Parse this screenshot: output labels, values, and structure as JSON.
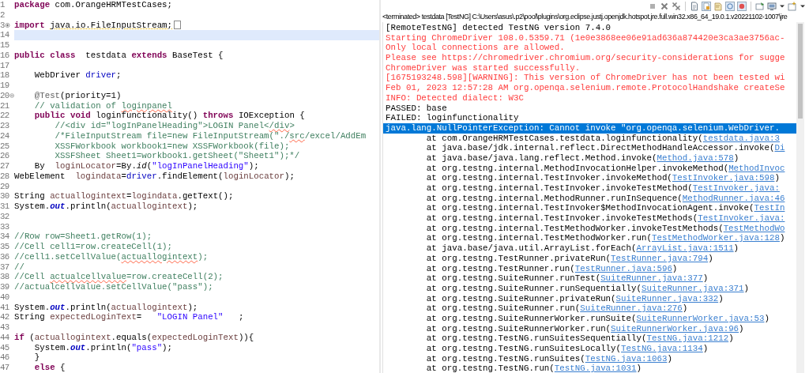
{
  "editor": {
    "lines": [
      {
        "number": "1",
        "current": false,
        "segments": [
          {
            "kind": "keyword",
            "text": "package"
          },
          {
            "kind": "plain",
            "text": " com.OrangeHRMTestCases;"
          }
        ]
      },
      {
        "number": "2",
        "current": false
      },
      {
        "number": "3",
        "current": false,
        "collapsed": true,
        "segments": [
          {
            "kind": "keyword",
            "text": "import "
          },
          {
            "kind": "plain",
            "text": "java.io.FileInputStream;",
            "warning": true
          }
        ]
      },
      {
        "number": "14",
        "current": true
      },
      {
        "number": "15",
        "current": false
      },
      {
        "number": "16",
        "current": false,
        "segments": [
          {
            "kind": "keyword",
            "text": "public class"
          },
          {
            "kind": "plain",
            "text": "  testdata "
          },
          {
            "kind": "keyword",
            "text": "extends"
          },
          {
            "kind": "plain",
            "text": " BaseTest {"
          }
        ]
      },
      {
        "number": "17",
        "current": false
      },
      {
        "number": "18",
        "current": false,
        "segments": [
          {
            "kind": "plain",
            "text": "    WebDriver "
          },
          {
            "kind": "field",
            "text": "driver"
          },
          {
            "kind": "plain",
            "text": ";"
          }
        ]
      },
      {
        "number": "19",
        "current": false
      },
      {
        "number": "20",
        "current": false,
        "collapsed": false,
        "segments": [
          {
            "kind": "annotation",
            "text": "    @Test"
          },
          {
            "kind": "plain",
            "text": "(priority=1)"
          }
        ]
      },
      {
        "number": "21",
        "current": false,
        "segments": [
          {
            "kind": "comment",
            "text": "    // validation of "
          },
          {
            "kind": "comment",
            "text": "loginpanel",
            "misspelled": true
          }
        ]
      },
      {
        "number": "22",
        "current": false,
        "segments": [
          {
            "kind": "keyword",
            "text": "    public void"
          },
          {
            "kind": "plain",
            "text": " loginfunctionality() "
          },
          {
            "kind": "keyword",
            "text": "throws"
          },
          {
            "kind": "plain",
            "text": " IOException {"
          }
        ]
      },
      {
        "number": "23",
        "current": false,
        "segments": [
          {
            "kind": "comment",
            "text": "        //<div id=\"logInPanelHeading\">LOGIN Panel<"
          },
          {
            "kind": "comment",
            "text": "/div",
            "misspelled": true
          },
          {
            "kind": "comment",
            "text": ">"
          }
        ]
      },
      {
        "number": "24",
        "current": false,
        "segments": [
          {
            "kind": "comment",
            "text": "        /*FileInputStream file=new FileInputStream(\"./"
          },
          {
            "kind": "comment",
            "text": "src",
            "misspelled": true
          },
          {
            "kind": "comment",
            "text": "/excel/AddEm"
          }
        ]
      },
      {
        "number": "25",
        "current": false,
        "segments": [
          {
            "kind": "comment",
            "text": "        XSSFWorkbook workbook1=new XSSFWorkbook(file);"
          }
        ]
      },
      {
        "number": "26",
        "current": false,
        "segments": [
          {
            "kind": "comment",
            "text": "        XSSFSheet Sheet1=workbook1.getSheet(\"Sheet1\");*/"
          }
        ]
      },
      {
        "number": "27",
        "current": false,
        "segments": [
          {
            "kind": "plain",
            "text": "    By  "
          },
          {
            "kind": "local",
            "text": "loginLocator"
          },
          {
            "kind": "plain",
            "text": "=By."
          },
          {
            "kind": "static-method",
            "text": "id"
          },
          {
            "kind": "plain",
            "text": "("
          },
          {
            "kind": "string",
            "text": "\"logInPanelHeading\""
          },
          {
            "kind": "plain",
            "text": ");"
          }
        ]
      },
      {
        "number": "28",
        "current": false,
        "segments": [
          {
            "kind": "plain",
            "text": "WebElement  "
          },
          {
            "kind": "local",
            "text": "logindata"
          },
          {
            "kind": "plain",
            "text": "="
          },
          {
            "kind": "field",
            "text": "driver"
          },
          {
            "kind": "plain",
            "text": ".findElement("
          },
          {
            "kind": "local",
            "text": "loginLocator"
          },
          {
            "kind": "plain",
            "text": ");"
          }
        ]
      },
      {
        "number": "29",
        "current": false
      },
      {
        "number": "30",
        "current": false,
        "segments": [
          {
            "kind": "plain",
            "text": "String "
          },
          {
            "kind": "local",
            "text": "actuallogintext"
          },
          {
            "kind": "plain",
            "text": "="
          },
          {
            "kind": "local",
            "text": "logindata"
          },
          {
            "kind": "plain",
            "text": ".getText();"
          }
        ]
      },
      {
        "number": "31",
        "current": false,
        "segments": [
          {
            "kind": "plain",
            "text": "System."
          },
          {
            "kind": "static-field",
            "text": "out"
          },
          {
            "kind": "plain",
            "text": ".println("
          },
          {
            "kind": "local",
            "text": "actuallogintext"
          },
          {
            "kind": "plain",
            "text": ");"
          }
        ]
      },
      {
        "number": "32",
        "current": false
      },
      {
        "number": "33",
        "current": false
      },
      {
        "number": "34",
        "current": false,
        "segments": [
          {
            "kind": "comment",
            "text": "//Row row=Sheet1.getRow(1);"
          }
        ]
      },
      {
        "number": "35",
        "current": false,
        "segments": [
          {
            "kind": "comment",
            "text": "//Cell cell1=row.createCell(1);"
          }
        ]
      },
      {
        "number": "36",
        "current": false,
        "segments": [
          {
            "kind": "comment",
            "text": "//cell1.setCellValue("
          },
          {
            "kind": "comment",
            "text": "actuallogintext",
            "misspelled": true
          },
          {
            "kind": "comment",
            "text": ");"
          }
        ]
      },
      {
        "number": "37",
        "current": false,
        "segments": [
          {
            "kind": "comment",
            "text": "//"
          }
        ]
      },
      {
        "number": "38",
        "current": false,
        "segments": [
          {
            "kind": "comment",
            "text": "//Cell "
          },
          {
            "kind": "comment",
            "text": "actualcellvalue",
            "misspelled": true
          },
          {
            "kind": "comment",
            "text": "=row.createCell(2);"
          }
        ]
      },
      {
        "number": "39",
        "current": false,
        "segments": [
          {
            "kind": "comment",
            "text": "//actualcellvalue.setCellValue(\"pass\");"
          }
        ]
      },
      {
        "number": "40",
        "current": false
      },
      {
        "number": "41",
        "current": false,
        "segments": [
          {
            "kind": "plain",
            "text": "System."
          },
          {
            "kind": "static-field",
            "text": "out"
          },
          {
            "kind": "plain",
            "text": ".println("
          },
          {
            "kind": "local",
            "text": "actuallogintext"
          },
          {
            "kind": "plain",
            "text": ");"
          }
        ]
      },
      {
        "number": "42",
        "current": false,
        "segments": [
          {
            "kind": "plain",
            "text": "String "
          },
          {
            "kind": "local",
            "text": "expectedLoginText"
          },
          {
            "kind": "plain",
            "text": "=   "
          },
          {
            "kind": "string",
            "text": "\"LOGIN Panel\""
          },
          {
            "kind": "plain",
            "text": "   ;"
          }
        ]
      },
      {
        "number": "43",
        "current": false
      },
      {
        "number": "44",
        "current": false,
        "segments": [
          {
            "kind": "keyword",
            "text": "if"
          },
          {
            "kind": "plain",
            "text": " ("
          },
          {
            "kind": "local",
            "text": "actuallogintext"
          },
          {
            "kind": "plain",
            "text": ".equals("
          },
          {
            "kind": "local",
            "text": "expectedLoginText"
          },
          {
            "kind": "plain",
            "text": ")){"
          }
        ]
      },
      {
        "number": "45",
        "current": false,
        "segments": [
          {
            "kind": "plain",
            "text": "    System."
          },
          {
            "kind": "static-field",
            "text": "out"
          },
          {
            "kind": "plain",
            "text": ".println("
          },
          {
            "kind": "string",
            "text": "\"pass\""
          },
          {
            "kind": "plain",
            "text": ");"
          }
        ]
      },
      {
        "number": "46",
        "current": false,
        "segments": [
          {
            "kind": "plain",
            "text": "    }"
          }
        ]
      },
      {
        "number": "47",
        "current": false,
        "segments": [
          {
            "kind": "keyword",
            "text": "    else"
          },
          {
            "kind": "plain",
            "text": " {"
          }
        ]
      }
    ]
  },
  "console": {
    "label": "<terminated> testdata [TestNG] C:\\Users\\asus\\.p2\\pool\\plugins\\org.eclipse.justj.openjdk.hotspot.jre.full.win32.x86_64_19.0.1.v20221102-1007\\jre",
    "lines": [
      {
        "error": false,
        "selected": false,
        "text": "[RemoteTestNG] detected TestNG version 7.4.0"
      },
      {
        "error": true,
        "selected": false,
        "text": "Starting ChromeDriver 108.0.5359.71 (1e0e3868ee06e91ad636a874420e3ca3ae3756ac-"
      },
      {
        "error": true,
        "selected": false,
        "text": "Only local connections are allowed."
      },
      {
        "error": true,
        "selected": false,
        "text": "Please see https://chromedriver.chromium.org/security-considerations for sugge"
      },
      {
        "error": true,
        "selected": false,
        "text": "ChromeDriver was started successfully."
      },
      {
        "error": true,
        "selected": false,
        "text": "[1675193248.598][WARNING]: This version of ChromeDriver has not been tested wi"
      },
      {
        "error": true,
        "selected": false,
        "text": "Feb 01, 2023 12:57:28 AM org.openqa.selenium.remote.ProtocolHandshake createSe"
      },
      {
        "error": true,
        "selected": false,
        "text": "INFO: Detected dialect: W3C"
      },
      {
        "error": false,
        "selected": false,
        "text": "PASSED: base"
      },
      {
        "error": false,
        "selected": false,
        "text": "FAILED: loginfunctionality"
      },
      {
        "error": false,
        "selected": true,
        "text": "java.lang.NullPointerException: Cannot invoke \"org.openqa.selenium.WebDriver."
      },
      {
        "error": false,
        "selected": false,
        "text": "\tat com.OrangeHRMTestCases.testdata.loginfunctionality(",
        "link": "testdata.java:3"
      },
      {
        "error": false,
        "selected": false,
        "text": "\tat java.base/jdk.internal.reflect.DirectMethodHandleAccessor.invoke(",
        "link": "Di"
      },
      {
        "error": false,
        "selected": false,
        "text": "\tat java.base/java.lang.reflect.Method.invoke(",
        "link": "Method.java:578",
        "tail": ")"
      },
      {
        "error": false,
        "selected": false,
        "text": "\tat org.testng.internal.MethodInvocationHelper.invokeMethod(",
        "link": "MethodInvoc"
      },
      {
        "error": false,
        "selected": false,
        "text": "\tat org.testng.internal.TestInvoker.invokeMethod(",
        "link": "TestInvoker.java:598",
        "tail": ")"
      },
      {
        "error": false,
        "selected": false,
        "text": "\tat org.testng.internal.TestInvoker.invokeTestMethod(",
        "link": "TestInvoker.java:"
      },
      {
        "error": false,
        "selected": false,
        "text": "\tat org.testng.internal.MethodRunner.runInSequence(",
        "link": "MethodRunner.java:46"
      },
      {
        "error": false,
        "selected": false,
        "text": "\tat org.testng.internal.TestInvoker$MethodInvocationAgent.invoke(",
        "link": "TestIn"
      },
      {
        "error": false,
        "selected": false,
        "text": "\tat org.testng.internal.TestInvoker.invokeTestMethods(",
        "link": "TestInvoker.java:"
      },
      {
        "error": false,
        "selected": false,
        "text": "\tat org.testng.internal.TestMethodWorker.invokeTestMethods(",
        "link": "TestMethodWo"
      },
      {
        "error": false,
        "selected": false,
        "text": "\tat org.testng.internal.TestMethodWorker.run(",
        "link": "TestMethodWorker.java:128",
        "tail": ")"
      },
      {
        "error": false,
        "selected": false,
        "text": "\tat java.base/java.util.ArrayList.forEach(",
        "link": "ArrayList.java:1511",
        "tail": ")"
      },
      {
        "error": false,
        "selected": false,
        "text": "\tat org.testng.TestRunner.privateRun(",
        "link": "TestRunner.java:794",
        "tail": ")"
      },
      {
        "error": false,
        "selected": false,
        "text": "\tat org.testng.TestRunner.run(",
        "link": "TestRunner.java:596",
        "tail": ")"
      },
      {
        "error": false,
        "selected": false,
        "text": "\tat org.testng.SuiteRunner.runTest(",
        "link": "SuiteRunner.java:377",
        "tail": ")"
      },
      {
        "error": false,
        "selected": false,
        "text": "\tat org.testng.SuiteRunner.runSequentially(",
        "link": "SuiteRunner.java:371",
        "tail": ")"
      },
      {
        "error": false,
        "selected": false,
        "text": "\tat org.testng.SuiteRunner.privateRun(",
        "link": "SuiteRunner.java:332",
        "tail": ")"
      },
      {
        "error": false,
        "selected": false,
        "text": "\tat org.testng.SuiteRunner.run(",
        "link": "SuiteRunner.java:276",
        "tail": ")"
      },
      {
        "error": false,
        "selected": false,
        "text": "\tat org.testng.SuiteRunnerWorker.runSuite(",
        "link": "SuiteRunnerWorker.java:53",
        "tail": ")"
      },
      {
        "error": false,
        "selected": false,
        "text": "\tat org.testng.SuiteRunnerWorker.run(",
        "link": "SuiteRunnerWorker.java:96",
        "tail": ")"
      },
      {
        "error": false,
        "selected": false,
        "text": "\tat org.testng.TestNG.runSuitesSequentially(",
        "link": "TestNG.java:1212",
        "tail": ")"
      },
      {
        "error": false,
        "selected": false,
        "text": "\tat org.testng.TestNG.runSuitesLocally(",
        "link": "TestNG.java:1134",
        "tail": ")"
      },
      {
        "error": false,
        "selected": false,
        "text": "\tat org.testng.TestNG.runSuites(",
        "link": "TestNG.java:1063",
        "tail": ")"
      },
      {
        "error": false,
        "selected": false,
        "text": "\tat org.testng.TestNG.run(",
        "link": "TestNG.java:1031",
        "tail": ")"
      }
    ]
  }
}
